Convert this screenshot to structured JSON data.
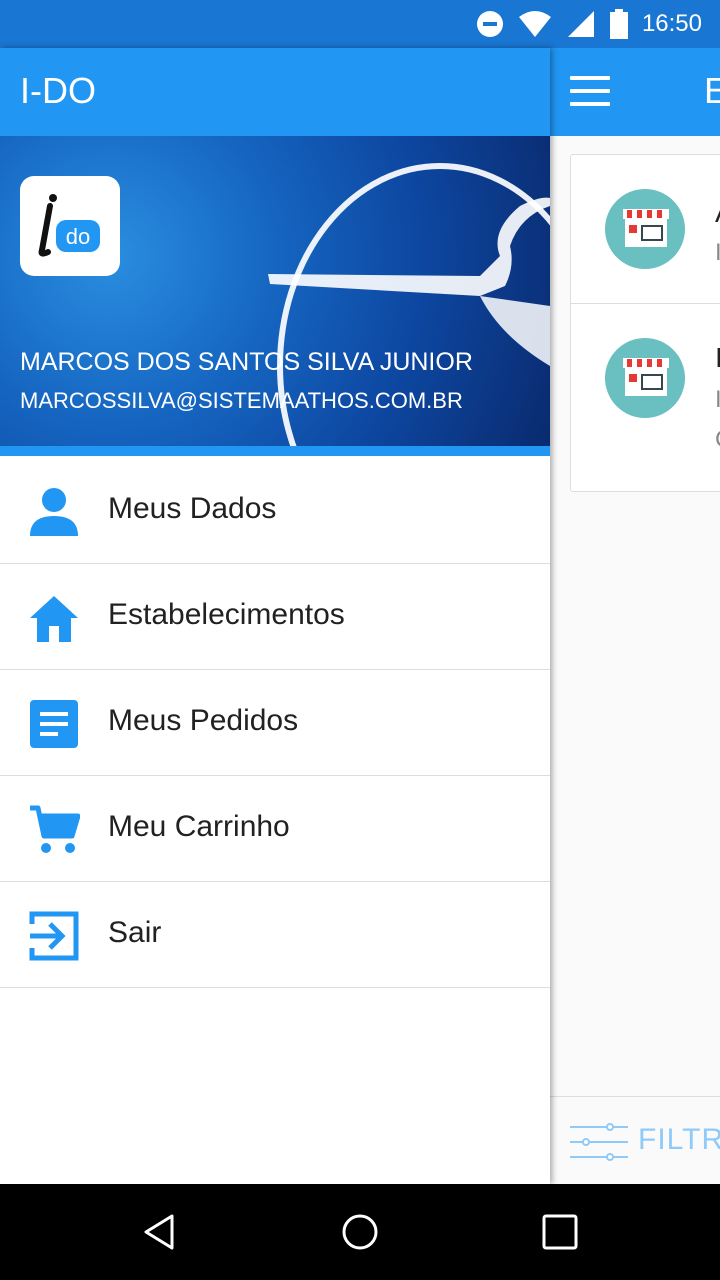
{
  "status_bar": {
    "time": "16:50",
    "icons": [
      "dnd-icon",
      "wifi-icon",
      "signal-icon",
      "battery-icon"
    ]
  },
  "app": {
    "title": "I-DO"
  },
  "background_screen": {
    "title_partial": "E",
    "cards": [
      {
        "title_partial": "A",
        "subtitle_partial": "I"
      },
      {
        "title_partial": "I",
        "subtitle_partial": "I",
        "extra_partial": "C"
      }
    ],
    "filter_label_partial": "FILTR"
  },
  "drawer": {
    "logo_text": "i-do",
    "user_name": "MARCOS DOS SANTOS SILVA JUNIOR",
    "user_email": "MARCOSSILVA@SISTEMAATHOS.COM.BR",
    "menu": [
      {
        "label": "Meus Dados",
        "icon": "person-icon"
      },
      {
        "label": "Estabelecimentos",
        "icon": "home-icon"
      },
      {
        "label": "Meus Pedidos",
        "icon": "document-icon"
      },
      {
        "label": "Meu Carrinho",
        "icon": "cart-icon"
      },
      {
        "label": "Sair",
        "icon": "exit-icon"
      }
    ]
  },
  "colors": {
    "primary": "#2196F3",
    "primary_dark": "#1976D2",
    "icon_blue": "#2196F3",
    "avatar_teal": "#6ABFC0"
  }
}
